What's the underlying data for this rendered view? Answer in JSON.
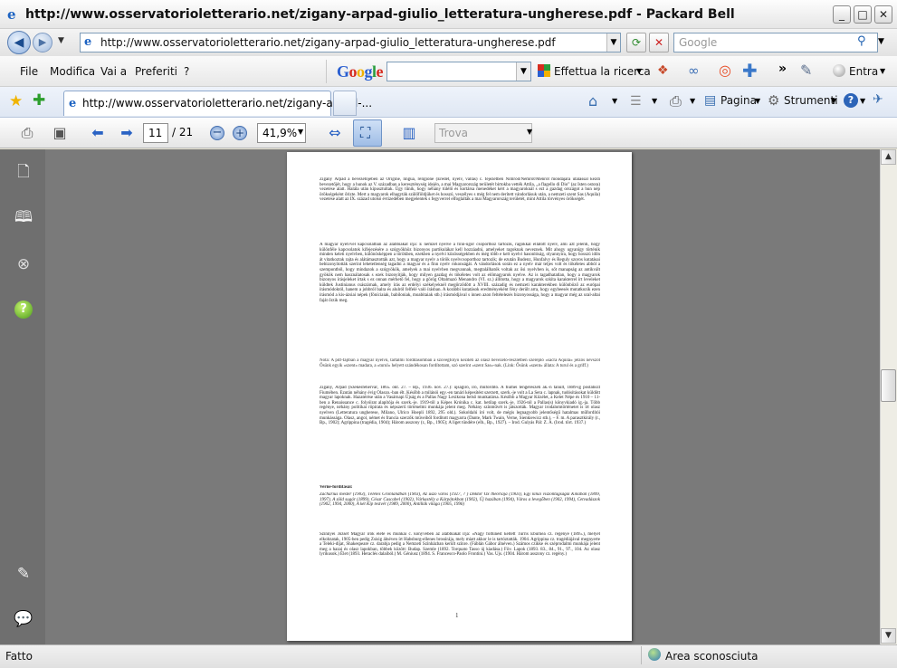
{
  "window": {
    "title": "http://www.osservatorioletterario.net/zigany-arpad-giulio_letteratura-ungherese.pdf - Packard Bell",
    "minimize": "_",
    "maximize": "□",
    "close": "✕"
  },
  "address_bar": {
    "url": "http://www.osservatorioletterario.net/zigany-arpad-giulio_letteratura-ungherese.pdf",
    "search_placeholder": "Google"
  },
  "menu": {
    "items": [
      "File",
      "Modifica",
      "Vai a",
      "Preferiti",
      "?"
    ]
  },
  "google_toolbar": {
    "logo_g1": "G",
    "logo_o1": "o",
    "logo_o2": "o",
    "logo_g2": "g",
    "logo_l": "l",
    "logo_e": "e",
    "search_button": "Effettua la ricerca",
    "signin": "Entra"
  },
  "tabs": {
    "active_label": "http://www.osservatorioletterario.net/zigany-arpad-...",
    "page_menu": "Pagina",
    "tools_menu": "Strumenti"
  },
  "pdf_toolbar": {
    "current_page": "11",
    "total_pages": "/ 21",
    "zoom": "41,9%",
    "find_placeholder": "Trova"
  },
  "document": {
    "p1": "Zigány Árpád a bevezetőjében az Origine, lingua, religione (Eredet, nyelv, vallás) c. fejezetben Nimród/Nemrót/Menrót mondájára utalással kezdi bevezetőjét, hogy a hunok az V. században a kereszténység idején, a mai Magyarország területét birtokba vették Attila, „a flagello di Dio” (az Isten ostora) vezetése alatt. Halála után kipusztultak. Úgy tűnik, hogy néhány túlélő és kortársa menedéket kért a magyaroknál s ezt a gazdag országot a hun nép örökségeként őrizte. Mert a magyarok elhagyták szülőföldjüket és hosszú, veszélyes s még fel nem derített vándorlásuk után, a nemzeti szent Sas (Aquila) vezetése alatt az IX. század utolsó évtizedében megjelentek s fegyverrel elfoglalták a mai Magyarország területét, mint Attila törvényes örökségét.",
    "p2": "A magyar nyelvvel kapcsolatban az alábbiakat írja: E nemzet nyelve a finn-ugor csoporthoz tartozik, ragokkal ellátott nyelv, ami azt jelenti, hogy különféle kapcsolatok kifejezésére a szógyökhöz bizonyos partikulákat kell hozzáadni, amelyeket ragoknak neveznek. Mit ahogy ugyanígy történik minden keleti nyelvben, különösképpen a törökben, ezekben a nyelvi közösségekben és még több e kelt nyelvi hasonlóság, olyannyira, hogy hosszú időn át vitatkoztak rajta és alátámasztották azt, hogy a magyar nyelv a török nyelvcsoporthoz tartozik; de ezután Budenz, Hunfalvy és Reguly szoros kutatásai bebizonyították szerint lehetetlenség tagadni a magyar és a finn nyelv rokonságát. A vándorlások során ez a nyelv már teljes volt és tökéletes abból a szempontból, hogy mindazok a szógyökök, amelyek a mai nyelvben megvannak, megtalálhatók voltak az ősi nyelvben is, sőt manapság az antikvált gyökök nem használatosak s ezek bizonyítják, hogy milyen gazdag és tökéletes volt az előmagyarok nyelve. Az is tagadhatatlan, hogy a magyarok bizonyos írásjeleket írtak s ez onnan mérhető fel, hogy a görög Oltalmazó Menandro (VI. sz.) állította, hogy a magyarok szkíta karakterrel írt leveleket küldtek Justinianus császárnak, amely írás az erdélyi székelyeknél megőrződött a XVIII. századig és nemzeti karakterekben különböző az európai írásmódoktól, hanem a jobbról balra és alulról felfelé való írásban. A korábbi kutatások eredményeként fény derült arra, hogy egybeesés mutatkozik ezen írásmód a kis-ázsiai népek (föníciaiak, babiloniak, moabitaiak stb.) írásmódjával s innen azon feltételezés bizonyossága, hogy a magyar még az ural-altai faját őrzik meg.",
    "note": "Nota: A pdf-fájlban a magyar nyelvű, tartalmi fordításomban a szövegfolyó kezdeti az olasz bevezető-részletben szereplő «sacra Aquila» jelzős névszót Ősünk egyik «szent» madara, a «turul» helyett szándékosan fordítottam, szó szerint «szent Sas»-nak. (Link: Ősünk «szent» állata: A turul és a griff.)",
    "bio": "Zigány, Árpád (Székesfehérvár, 1865. okt. 27. – Bp., 1936. nov. 27.): újságíró, író, műfordító. A fiumei tengerészeti ak.-n tanult, 1889-ig postatiszt Fiumében. Ezután néhány évig Olaszo.-ban élt. Később a milánói egy.-en tanári képesítést szerzett, szerk.-je volt a La Sera c. lapnak, tudósításokat küldött magyar lapoknak. Hazatérése után a Vasárnapi Újság és a Pallas Nagy Lexikona belső munkatársa. Később a Magyar Közélet, a Kelet Népe és 1910 – 11-ben a Renaissance c. folyóirat alapítója és szerk.-je. 1919-től a Képes Krónika c. kat. hetilap szerk.-je, 1926-tól a Pallas(s) könyvkiadó ig.-ja. Több regénye, néhány politikai röpirata és népszerű történelmi munkája jelent meg. Néhány színművét is játszották. Magyar irodalomtörténetet is írt olasz nyelven (Letteratura ungherese, Milano, Ulrico Hoepli 1892, 295 old.). Sokoldalú író volt, de mégis legnagyobb jelentőségű hatalmas műfordítói munkássága. Olasz, angol, német és francia szerzők műveiből fordított magyarra (Dante, Mark Twain, Verne, Sienkiewicz stb.). – F. m. A parasztkirály (r., Bp., 1902); Agrippina (tragédia, 1904); Három asszony (r., Bp., 1905); A liget tündére (elb., Bp., 1927). – Irod. Gulyás Pál: Z. Á. (Irod. tört. 1937.)",
    "verne_title": "Verne-fordításai:",
    "verne_list": "Zacharius mester (1903), Télelés Grönlandban (1903), Az úszó város (1927, ? ) Doktor Ox theóriája (1903), Egy kínai viszontagságai Kínában (1899, 1997), A zöld sugár (1899), César Cascabel (1902), Várkastély a Kárpátokban (1902), Új hazában (1994), Város a levegőben (1902, 1994), Cetvadászok (1902, 1994, 2000), A két Kip testvér (1989, 2000), Antillák világa (1905, 1996)",
    "szinnyei": "Szinnyei József Magyar írók élete és munkái c. könyvében az alábbiakat írja: «Nagy föltűnést keltett Turris Eburnea cz. regénye (1895.), melyet elkobzatak, 1905-ben pedig Zsisig álnéven írt Habsburg-ellenes brosúrája, mely miatt akkor le is tartóztatták. 1904. Agrippina cz. tragédiájával megnyerte a Teleki-díjat, Shakespeare cz. darabja pedig a Nemzeti Színházban került színre. (Fáblán Gábor álnéven.) Számos czikke és széprodalmi munkája jelent meg a hazai és olasz lapokban, többek között: Budap. Szemle (1892. Torquato Tasso új kiadása.) Föv. Lapok (1893. 83., 84., 91., 97., 104. Az olasz lyrikusok.) Élet (1893. Heraclés dalaiból.) M. Géniusz (1894. S. Francesco-Paolo Frontini.) Vas. Ujs. (1904. Három asszony cz. regény.)",
    "page_number": "1"
  },
  "status_bar": {
    "status": "Fatto",
    "zone": "Area sconosciuta"
  },
  "colors": {
    "accent": "#1d63c2",
    "pdf_background": "#7a7a7a"
  }
}
